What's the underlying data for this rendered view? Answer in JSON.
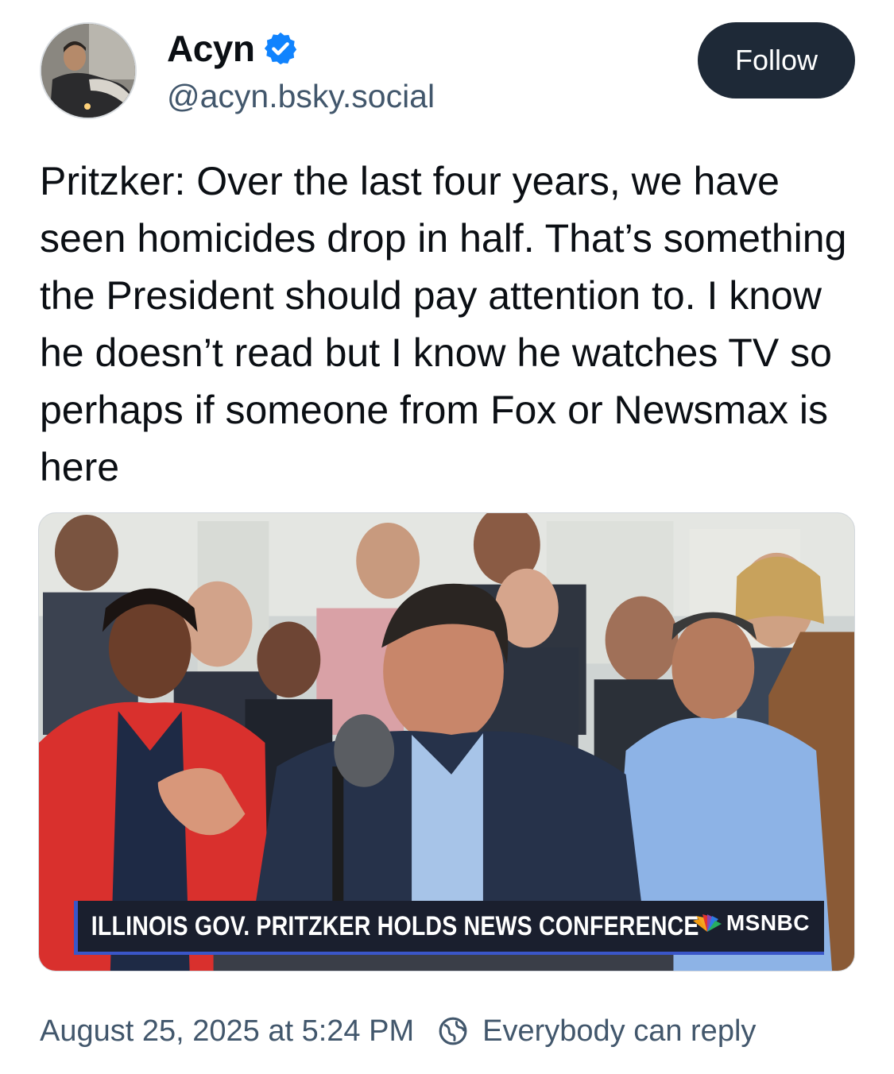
{
  "author": {
    "display_name": "Acyn",
    "handle": "@acyn.bsky.social",
    "verified": true,
    "avatar_icon": "avatar-photo"
  },
  "actions": {
    "follow_label": "Follow"
  },
  "post": {
    "text": "Pritzker: Over the last four years, we have seen homicides drop in half. That’s something the President should pay attention to. I know he doesn’t read but I know he watches TV so perhaps if someone from Fox or Newsmax is here"
  },
  "media": {
    "chyron_text": "ILLINOIS GOV. PRITZKER HOLDS NEWS CONFERENCE",
    "network_label": "MSNBC"
  },
  "footer": {
    "timestamp": "August 25, 2025 at 5:24 PM",
    "reply_setting": "Everybody can reply"
  },
  "colors": {
    "follow_bg": "#1e2937",
    "verified": "#1083fe",
    "muted_text": "#42576c",
    "chyron_bg": "#1a1f2e",
    "chyron_accent": "#3a56c8"
  }
}
